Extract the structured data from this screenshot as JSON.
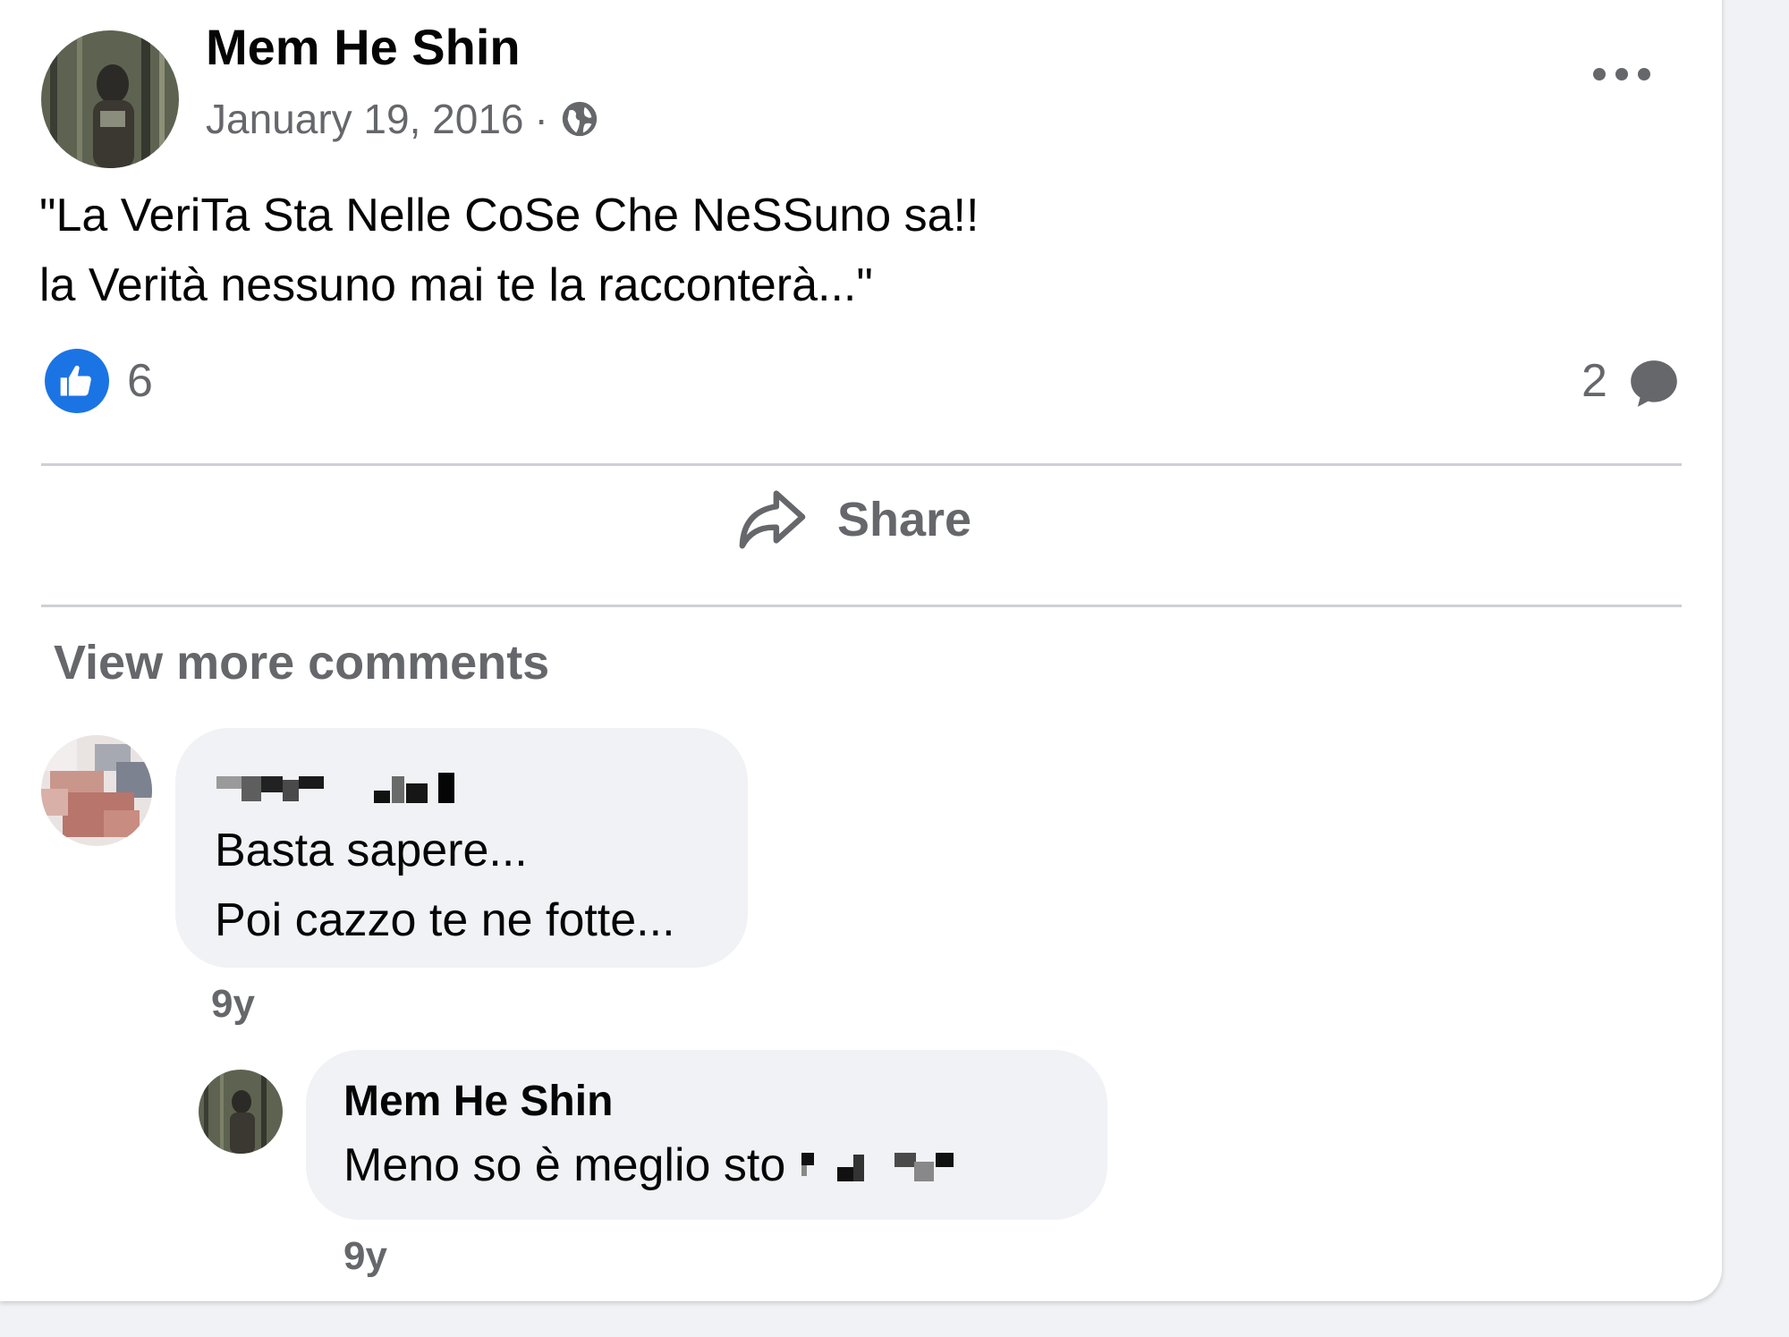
{
  "post": {
    "author": "Mem He Shin",
    "date": "January 19, 2016",
    "separator": "·",
    "privacy_icon": "globe-icon",
    "text": "\"La VeriTa Sta Nelle CoSe Che NeSSuno sa!!\nla Verità nessuno mai te la racconterà...\"",
    "reactions": {
      "icon": "like-icon",
      "count": "6"
    },
    "comments_count": "2",
    "share_label": "Share",
    "view_more_label": "View more comments"
  },
  "comments": [
    {
      "author_redacted": true,
      "text": "Basta sapere...\nPoi cazzo te ne fotte...",
      "time": "9y"
    },
    {
      "author": "Mem He Shin",
      "text_prefix": "Meno so è meglio sto",
      "text_redacted": true,
      "time": "9y"
    }
  ],
  "colors": {
    "accent": "#1b74e4",
    "secondary_text": "#65676b",
    "bubble_bg": "#f0f2f5",
    "divider": "#ced0d4"
  }
}
